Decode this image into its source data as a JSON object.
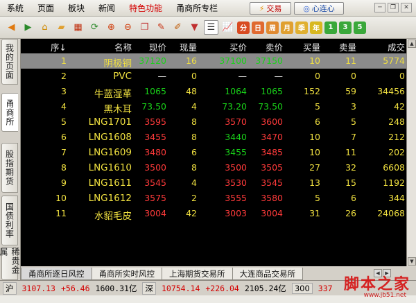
{
  "menu": {
    "items": [
      "系统",
      "页面",
      "板块",
      "新闻"
    ],
    "special": "特色功能",
    "column": "甬商所专栏",
    "trade_btn": "交易",
    "heart_btn": "心连心"
  },
  "toolbar": {
    "icons": [
      "back-icon",
      "forward-icon",
      "home-icon",
      "folder-icon",
      "calendar-icon",
      "refresh-icon",
      "zoom-in-icon",
      "zoom-out-icon",
      "copy-icon",
      "pen-icon",
      "brush-icon",
      "filter-icon",
      "list-view-icon",
      "chart-icon",
      "minute-icon",
      "day-icon",
      "week-icon",
      "month-icon",
      "quarter-icon",
      "year-icon",
      "period1-icon",
      "period3-icon",
      "period5-icon"
    ],
    "period_labels": [
      "分",
      "日",
      "周",
      "月",
      "季",
      "年",
      "1",
      "3",
      "5"
    ]
  },
  "sidebar": {
    "tabs": [
      "我的页面",
      "甬商所",
      "股指期货",
      "国债利率",
      "稀贵金属"
    ]
  },
  "table": {
    "headers": [
      "序↓",
      "名称",
      "现价",
      "现量",
      "买价",
      "卖价",
      "买量",
      "卖量",
      "成交"
    ],
    "rows": [
      {
        "seq": "1",
        "name": "阴极铜",
        "price": "37120",
        "vol": "16",
        "bid": "37100",
        "ask": "37150",
        "bidv": "10",
        "askv": "11",
        "deal": "5774"
      },
      {
        "seq": "2",
        "name": "PVC",
        "price": "—",
        "vol": "0",
        "bid": "—",
        "ask": "—",
        "bidv": "0",
        "askv": "0",
        "deal": "0"
      },
      {
        "seq": "3",
        "name": "牛蓝湿革",
        "price": "1065",
        "vol": "48",
        "bid": "1064",
        "ask": "1065",
        "bidv": "152",
        "askv": "59",
        "deal": "34456"
      },
      {
        "seq": "4",
        "name": "黑木耳",
        "price": "73.50",
        "vol": "4",
        "bid": "73.20",
        "ask": "73.50",
        "bidv": "5",
        "askv": "3",
        "deal": "42"
      },
      {
        "seq": "5",
        "name": "LNG1701",
        "price": "3595",
        "vol": "8",
        "bid": "3570",
        "ask": "3600",
        "bidv": "6",
        "askv": "5",
        "deal": "248"
      },
      {
        "seq": "6",
        "name": "LNG1608",
        "price": "3455",
        "vol": "8",
        "bid": "3440",
        "ask": "3470",
        "bidv": "10",
        "askv": "7",
        "deal": "212"
      },
      {
        "seq": "7",
        "name": "LNG1609",
        "price": "3480",
        "vol": "6",
        "bid": "3455",
        "ask": "3485",
        "bidv": "10",
        "askv": "11",
        "deal": "202"
      },
      {
        "seq": "8",
        "name": "LNG1610",
        "price": "3500",
        "vol": "8",
        "bid": "3500",
        "ask": "3505",
        "bidv": "27",
        "askv": "32",
        "deal": "6608"
      },
      {
        "seq": "9",
        "name": "LNG1611",
        "price": "3545",
        "vol": "4",
        "bid": "3530",
        "ask": "3545",
        "bidv": "13",
        "askv": "15",
        "deal": "1192"
      },
      {
        "seq": "10",
        "name": "LNG1612",
        "price": "3575",
        "vol": "2",
        "bid": "3555",
        "ask": "3580",
        "bidv": "5",
        "askv": "6",
        "deal": "344"
      },
      {
        "seq": "11",
        "name": "水貂毛皮",
        "price": "3004",
        "vol": "42",
        "bid": "3003",
        "ask": "3004",
        "bidv": "31",
        "askv": "26",
        "deal": "24068"
      }
    ],
    "row_colors": [
      {
        "price": "#19d119",
        "bid": "#19d119",
        "ask": "#19d119"
      },
      {
        "price": "#e8e8e8",
        "bid": "#e8e8e8",
        "ask": "#e8e8e8"
      },
      {
        "price": "#19d119",
        "bid": "#19d119",
        "ask": "#19d119"
      },
      {
        "price": "#19d119",
        "bid": "#19d119",
        "ask": "#19d119"
      },
      {
        "price": "#ff3a3a",
        "bid": "#ff3a3a",
        "ask": "#ff3a3a"
      },
      {
        "price": "#ff3a3a",
        "bid": "#19d119",
        "ask": "#ff3a3a"
      },
      {
        "price": "#ff3a3a",
        "bid": "#19d119",
        "ask": "#ff3a3a"
      },
      {
        "price": "#ff3a3a",
        "bid": "#ff3a3a",
        "ask": "#ff3a3a"
      },
      {
        "price": "#ff3a3a",
        "bid": "#ff3a3a",
        "ask": "#ff3a3a"
      },
      {
        "price": "#ff3a3a",
        "bid": "#ff3a3a",
        "ask": "#ff3a3a"
      },
      {
        "price": "#ff3a3a",
        "bid": "#ff3a3a",
        "ask": "#ff3a3a"
      }
    ]
  },
  "bottom_tabs": [
    "甬商所逐日风控",
    "甬商所实时风控",
    "上海期货交易所",
    "大连商品交易所"
  ],
  "status": {
    "sh_label": "沪",
    "sh_index": "3107.13",
    "sh_change": "+56.46",
    "sh_amount": "1600.31亿",
    "sz_label": "深",
    "sz_index": "10754.14",
    "sz_change": "+226.04",
    "sz_amount": "2105.24亿",
    "idx_label": "300",
    "idx_value": "337"
  },
  "watermark": {
    "text": "脚本之家",
    "url": "www.jb51.net"
  },
  "colors": {
    "yellow": "#f0e040",
    "white": "#e8e8e8",
    "green": "#19d119",
    "red": "#ff3a3a",
    "header": "#e8e8e8"
  }
}
